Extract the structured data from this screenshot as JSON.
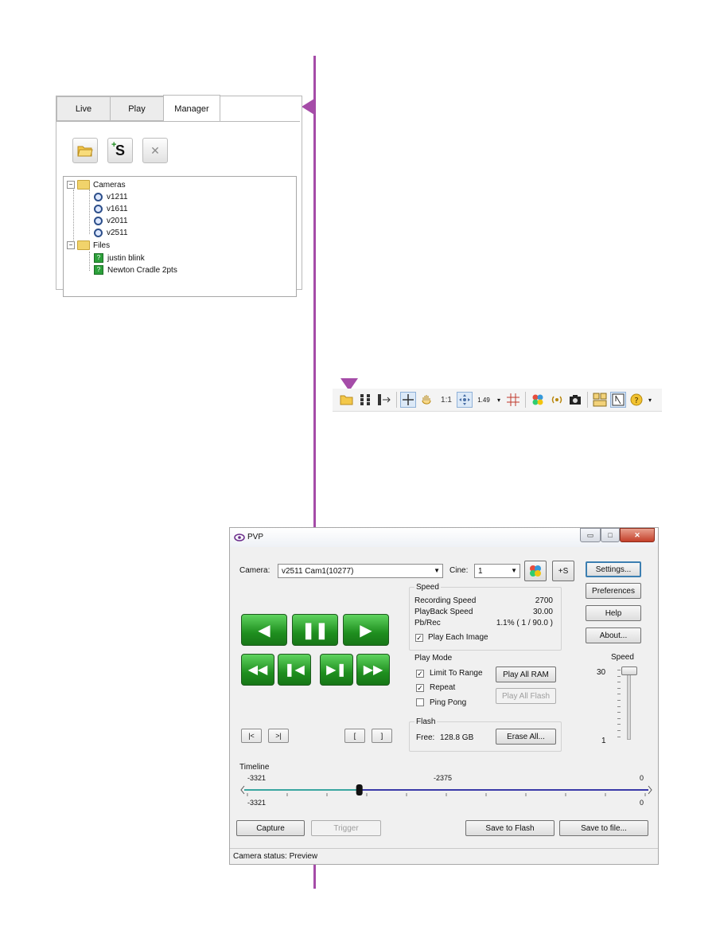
{
  "manager": {
    "tabs": [
      {
        "label": "Live"
      },
      {
        "label": "Play"
      },
      {
        "label": "Manager"
      }
    ],
    "toolbar_icons": [
      "open-folder-icon",
      "add-s-icon",
      "delete-x-icon"
    ],
    "add_label": "S",
    "delete_label": "✕",
    "tree": {
      "cameras_label": "Cameras",
      "cameras": [
        "v1211",
        "v1611",
        "v2011",
        "v2511"
      ],
      "files_label": "Files",
      "files": [
        "justin blink",
        "Newton Cradle 2pts"
      ]
    }
  },
  "toolbar": {
    "zoom_value": "1.49"
  },
  "pvp": {
    "title": "PVP",
    "camera_label": "Camera:",
    "camera_value": "v2511 Cam1(10277)",
    "cine_label": "Cine:",
    "cine_value": "1",
    "plus_s_label": "+S",
    "right_buttons": {
      "settings": "Settings...",
      "preferences": "Preferences",
      "help": "Help",
      "about": "About..."
    },
    "speed_group": {
      "title": "Speed",
      "rows": [
        {
          "label": "Recording Speed",
          "value": "2700"
        },
        {
          "label": "PlayBack Speed",
          "value": "30.00"
        },
        {
          "label": "Pb/Rec",
          "value": "1.1% ( 1 / 90.0 )"
        }
      ],
      "play_each_image_label": "Play Each Image",
      "play_each_image_checked": true
    },
    "play_mode": {
      "title": "Play Mode",
      "limit_to_range": {
        "label": "Limit To Range",
        "checked": true
      },
      "repeat": {
        "label": "Repeat",
        "checked": true
      },
      "ping_pong": {
        "label": "Ping Pong",
        "checked": false
      },
      "play_all_ram": "Play All RAM",
      "play_all_flash": "Play All Flash"
    },
    "flash": {
      "title": "Flash",
      "free_label": "Free:",
      "free_value": "128.8 GB",
      "erase_all": "Erase All..."
    },
    "speed_slider": {
      "label": "Speed",
      "max": "30",
      "min": "1",
      "value": 30
    },
    "nav_buttons": [
      "|<",
      ">|",
      "[",
      "]"
    ],
    "timeline": {
      "label": "Timeline",
      "top_left": "-3321",
      "top_center": "-2375",
      "top_right": "0",
      "bottom_left": "-3321",
      "bottom_right": "0",
      "min": -3321,
      "max": 0,
      "position": -2375
    },
    "buttons": {
      "capture": "Capture",
      "trigger": "Trigger",
      "save_to_flash": "Save to Flash",
      "save_to_file": "Save to file..."
    },
    "status": "Camera status: Preview"
  },
  "colors": {
    "guide": "#a54ca8",
    "play_green": "#1f8f1f",
    "timeline_blue": "#3a3aa8"
  }
}
